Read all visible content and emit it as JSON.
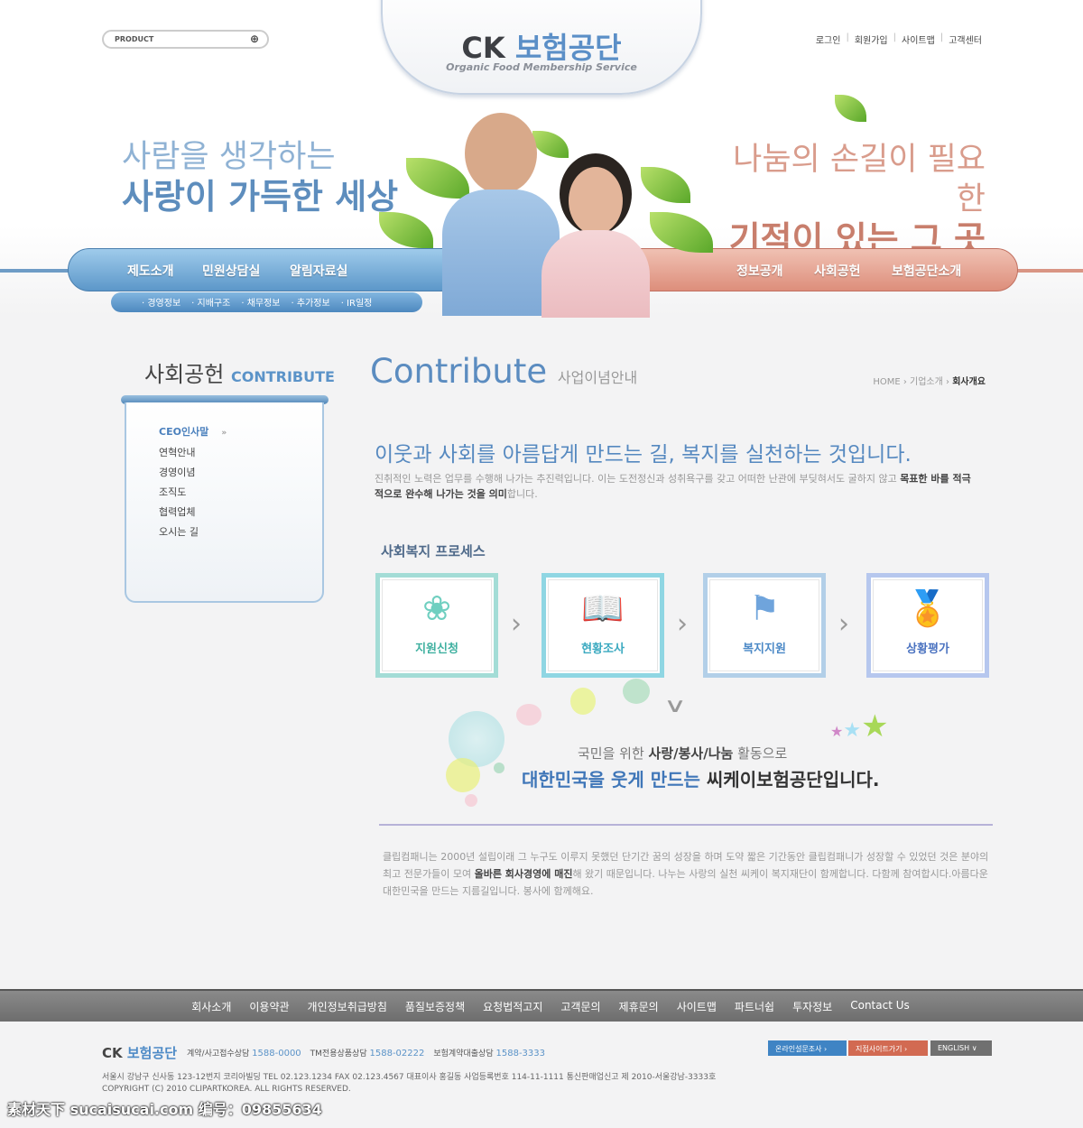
{
  "header": {
    "search_placeholder": "PRODUCT",
    "logo_ck": "CK",
    "logo_name": "보험공단",
    "logo_sub": "Organic Food Membership Service",
    "util": [
      "로그인",
      "회원가입",
      "사이트맵",
      "고객센터"
    ]
  },
  "hero": {
    "left_line1": "사람을 생각하는",
    "left_line2": "사랑이 가득한 세상",
    "right_line1": "나눔의 손길이 필요한",
    "right_line2": "기적이 있는 그 곳"
  },
  "nav": {
    "left": [
      "제도소개",
      "민원상담실",
      "알림자료실"
    ],
    "right": [
      "정보공개",
      "사회공헌",
      "보험공단소개"
    ],
    "sub": [
      "경영정보",
      "지배구조",
      "채무정보",
      "추가정보",
      "IR일정"
    ]
  },
  "sidebar": {
    "title": "사회공헌",
    "title_en": "CONTRIBUTE",
    "items": [
      "CEO인사말",
      "연혁안내",
      "경영이념",
      "조직도",
      "협력업체",
      "오시는 길"
    ],
    "active_marker": "»"
  },
  "main": {
    "title": "Contribute",
    "subtitle": "사업이념안내",
    "breadcrumb": [
      "HOME",
      "기업소개",
      "회사개요"
    ],
    "headline": "이웃과 사회를 아름답게 만드는 길, 복지를 실천하는 것입니다.",
    "intro_a": "진취적인 노력은 업무를 수행해 나가는 추진력입니다. 이는 도전정신과 성취욕구를 갖고 어떠한 난관에 부딪혀서도 굴하지 않고 ",
    "intro_b": "목표한 바를 적극적으로 완수해 나가는 것을 의미",
    "intro_c": "합니다.",
    "process_title": "사회복지 프로세스",
    "steps": [
      {
        "label": "지원신청",
        "icon": "tulip-icon",
        "color": "#8fd3cf"
      },
      {
        "label": "현황조사",
        "icon": "book-icon",
        "color": "#7fd0dc"
      },
      {
        "label": "복지지원",
        "icon": "flag-icon",
        "color": "#a9c8e4"
      },
      {
        "label": "상황평가",
        "icon": "medal-icon",
        "color": "#a8bde8"
      }
    ],
    "slogan1_a": "국민을 위한 ",
    "slogan1_b": "사랑/봉사/나눔",
    "slogan1_c": " 활동으로",
    "slogan2_a": "대한민국을 웃게 만드는",
    "slogan2_b": " 씨케이보험공단입니다.",
    "body_a": "클립컴패니는 2000년 설립이래 그 누구도 이루지 못했던 단기간 꿈의 성장을 하며 도약 짧은 기간동안 클립컴패니가 성장할 수 있었던 것은 분야의 최고 전문가들이 모여 ",
    "body_b": "올바른 회사경영에 매진",
    "body_c": "해 왔기 때문입니다. 나누는 사랑의 실천 씨케이 복지재단이 함께합니다. 다함께 참여합시다.아름다운 대한민국을 만드는 지름길입니다. 봉사에 함께해요."
  },
  "footer": {
    "nav": [
      "회사소개",
      "이용약관",
      "개인정보취급방침",
      "품질보증정책",
      "요청법적고지",
      "고객문의",
      "제휴문의",
      "사이트맵",
      "파트너쉽",
      "투자정보",
      "Contact Us"
    ],
    "logo_ck": "CK",
    "logo_name": "보험공단",
    "phones": [
      {
        "label": "계약/사고접수상담",
        "num": "1588-0000"
      },
      {
        "label": "TM전용상품상담",
        "num": "1588-02222"
      },
      {
        "label": "보험계약대출상담",
        "num": "1588-3333"
      }
    ],
    "buttons": [
      "온라인설문조사 ›",
      "지점사이트가기 ›",
      "ENGLISH ∨"
    ],
    "address": "서울시 강남구 신사동 123-12번지 코리아빌딩  TEL 02.123.1234   FAX 02.123.4567  대표이사 홍길동 사업등록번호 114-11-1111 통신판매업신고 제 2010-서울강남-3333호",
    "copyright": "COPYRIGHT (C) 2010 CLIPARTKOREA. ALL RIGHTS RESERVED."
  },
  "watermark": "素材天下 sucaisucai.com  编号：09855634",
  "colors": {
    "blue": "#5b8fc7",
    "salmon": "#dd8e7b",
    "footer": "#7a7a7a"
  }
}
